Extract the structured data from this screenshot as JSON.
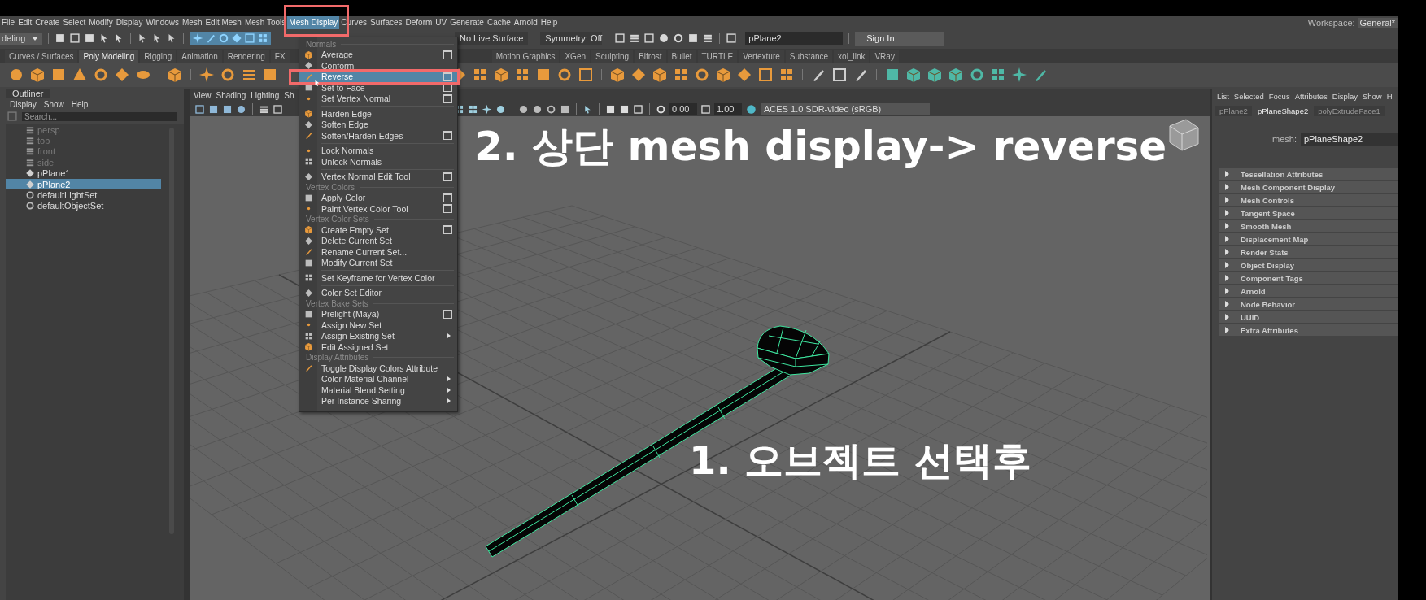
{
  "menu_bar": {
    "items": [
      {
        "label": "File",
        "selected": false
      },
      {
        "label": "Edit",
        "selected": false
      },
      {
        "label": "Create",
        "selected": false
      },
      {
        "label": "Select",
        "selected": false
      },
      {
        "label": "Modify",
        "selected": false
      },
      {
        "label": "Display",
        "selected": false
      },
      {
        "label": "Windows",
        "selected": false
      },
      {
        "label": "Mesh",
        "selected": false
      },
      {
        "label": "Edit Mesh",
        "selected": false
      },
      {
        "label": "Mesh Tools",
        "selected": false
      },
      {
        "label": "Mesh Display",
        "selected": true
      },
      {
        "label": "Curves",
        "selected": false
      },
      {
        "label": "Surfaces",
        "selected": false
      },
      {
        "label": "Deform",
        "selected": false
      },
      {
        "label": "UV",
        "selected": false
      },
      {
        "label": "Generate",
        "selected": false
      },
      {
        "label": "Cache",
        "selected": false
      },
      {
        "label": "Arnold",
        "selected": false
      },
      {
        "label": "Help",
        "selected": false
      }
    ],
    "workspace_label": "Workspace:",
    "workspace_value": "General*"
  },
  "status_line": {
    "menu_set": "deling",
    "live_surface": "No Live Surface",
    "symmetry": "Symmetry: Off",
    "name_field": "pPlane2",
    "sign_in": "Sign In"
  },
  "shelf": {
    "tabs": [
      {
        "label": "Curves / Surfaces",
        "selected": false
      },
      {
        "label": "Poly Modeling",
        "selected": true
      },
      {
        "label": "Rigging",
        "selected": false
      },
      {
        "label": "Animation",
        "selected": false
      },
      {
        "label": "Rendering",
        "selected": false
      },
      {
        "label": "FX",
        "selected": false
      },
      {
        "label": "Motion Graphics",
        "selected": false
      },
      {
        "label": "XGen",
        "selected": false
      },
      {
        "label": "Sculpting",
        "selected": false
      },
      {
        "label": "Bifrost",
        "selected": false
      },
      {
        "label": "Bullet",
        "selected": false
      },
      {
        "label": "TURTLE",
        "selected": false
      },
      {
        "label": "Vertexture",
        "selected": false
      },
      {
        "label": "Substance",
        "selected": false
      },
      {
        "label": "xol_link",
        "selected": false
      },
      {
        "label": "VRay",
        "selected": false
      }
    ]
  },
  "outliner": {
    "title": "Outliner",
    "menu": [
      "Display",
      "Show",
      "Help"
    ],
    "placeholder": "Search...",
    "items": [
      {
        "label": "persp",
        "kind": "camera",
        "dimmed": true,
        "selected": false
      },
      {
        "label": "top",
        "kind": "camera",
        "dimmed": true,
        "selected": false
      },
      {
        "label": "front",
        "kind": "camera",
        "dimmed": true,
        "selected": false
      },
      {
        "label": "side",
        "kind": "camera",
        "dimmed": true,
        "selected": false
      },
      {
        "label": "pPlane1",
        "kind": "mesh",
        "dimmed": false,
        "selected": false
      },
      {
        "label": "pPlane2",
        "kind": "mesh",
        "dimmed": false,
        "selected": true
      },
      {
        "label": "defaultLightSet",
        "kind": "set",
        "dimmed": false,
        "selected": false
      },
      {
        "label": "defaultObjectSet",
        "kind": "set",
        "dimmed": false,
        "selected": false
      }
    ]
  },
  "viewport": {
    "menu": [
      "View",
      "Shading",
      "Lighting",
      "Sh"
    ],
    "exposure": "0.00",
    "gamma": "1.00",
    "color_space": "ACES 1.0 SDR-video (sRGB)"
  },
  "captions": [
    {
      "text": "2. 상단 mesh display-> reverse"
    },
    {
      "text": "1. 오브젝트 선택후"
    }
  ],
  "mesh_display_menu": {
    "items": [
      {
        "kind": "header",
        "label": "Normals"
      },
      {
        "kind": "item",
        "label": "Average",
        "has_icon": true,
        "option_box": true,
        "submenu": false,
        "highlighted": false
      },
      {
        "kind": "item",
        "label": "Conform",
        "has_icon": true,
        "option_box": false,
        "submenu": false,
        "highlighted": false
      },
      {
        "kind": "item",
        "label": "Reverse",
        "has_icon": true,
        "option_box": true,
        "submenu": false,
        "highlighted": true
      },
      {
        "kind": "item",
        "label": "Set to Face",
        "has_icon": true,
        "option_box": true,
        "submenu": false,
        "highlighted": false
      },
      {
        "kind": "item",
        "label": "Set Vertex Normal",
        "has_icon": true,
        "option_box": true,
        "submenu": false,
        "highlighted": false
      },
      {
        "kind": "separator"
      },
      {
        "kind": "item",
        "label": "Harden Edge",
        "has_icon": true,
        "option_box": false,
        "submenu": false,
        "highlighted": false
      },
      {
        "kind": "item",
        "label": "Soften Edge",
        "has_icon": true,
        "option_box": false,
        "submenu": false,
        "highlighted": false
      },
      {
        "kind": "item",
        "label": "Soften/Harden Edges",
        "has_icon": true,
        "option_box": true,
        "submenu": false,
        "highlighted": false
      },
      {
        "kind": "separator"
      },
      {
        "kind": "item",
        "label": "Lock Normals",
        "has_icon": true,
        "option_box": false,
        "submenu": false,
        "highlighted": false
      },
      {
        "kind": "item",
        "label": "Unlock Normals",
        "has_icon": true,
        "option_box": false,
        "submenu": false,
        "highlighted": false
      },
      {
        "kind": "separator"
      },
      {
        "kind": "item",
        "label": "Vertex Normal Edit Tool",
        "has_icon": true,
        "option_box": true,
        "submenu": false,
        "highlighted": false
      },
      {
        "kind": "header",
        "label": "Vertex Colors"
      },
      {
        "kind": "item",
        "label": "Apply Color",
        "has_icon": true,
        "option_box": true,
        "submenu": false,
        "highlighted": false
      },
      {
        "kind": "item",
        "label": "Paint Vertex Color Tool",
        "has_icon": true,
        "option_box": true,
        "submenu": false,
        "highlighted": false
      },
      {
        "kind": "header",
        "label": "Vertex Color Sets"
      },
      {
        "kind": "item",
        "label": "Create Empty Set",
        "has_icon": true,
        "option_box": true,
        "submenu": false,
        "highlighted": false
      },
      {
        "kind": "item",
        "label": "Delete Current Set",
        "has_icon": true,
        "option_box": false,
        "submenu": false,
        "highlighted": false
      },
      {
        "kind": "item",
        "label": "Rename Current Set...",
        "has_icon": true,
        "option_box": false,
        "submenu": false,
        "highlighted": false
      },
      {
        "kind": "item",
        "label": "Modify Current Set",
        "has_icon": true,
        "option_box": false,
        "submenu": false,
        "highlighted": false
      },
      {
        "kind": "separator"
      },
      {
        "kind": "item",
        "label": "Set Keyframe for Vertex Color",
        "has_icon": true,
        "option_box": false,
        "submenu": false,
        "highlighted": false
      },
      {
        "kind": "separator"
      },
      {
        "kind": "item",
        "label": "Color Set Editor",
        "has_icon": true,
        "option_box": false,
        "submenu": false,
        "highlighted": false
      },
      {
        "kind": "header",
        "label": "Vertex Bake Sets"
      },
      {
        "kind": "item",
        "label": "Prelight (Maya)",
        "has_icon": true,
        "option_box": true,
        "submenu": false,
        "highlighted": false
      },
      {
        "kind": "item",
        "label": "Assign New Set",
        "has_icon": true,
        "option_box": false,
        "submenu": false,
        "highlighted": false
      },
      {
        "kind": "item",
        "label": "Assign Existing Set",
        "has_icon": true,
        "option_box": false,
        "submenu": true,
        "highlighted": false
      },
      {
        "kind": "item",
        "label": "Edit Assigned Set",
        "has_icon": true,
        "option_box": false,
        "submenu": false,
        "highlighted": false
      },
      {
        "kind": "header",
        "label": "Display Attributes"
      },
      {
        "kind": "item",
        "label": "Toggle Display Colors Attribute",
        "has_icon": true,
        "option_box": false,
        "submenu": false,
        "highlighted": false
      },
      {
        "kind": "item",
        "label": "Color Material Channel",
        "has_icon": false,
        "option_box": false,
        "submenu": true,
        "highlighted": false
      },
      {
        "kind": "item",
        "label": "Material Blend Setting",
        "has_icon": false,
        "option_box": false,
        "submenu": true,
        "highlighted": false
      },
      {
        "kind": "item",
        "label": "Per Instance Sharing",
        "has_icon": false,
        "option_box": false,
        "submenu": true,
        "highlighted": false
      }
    ]
  },
  "attribute_editor": {
    "menu": [
      "List",
      "Selected",
      "Focus",
      "Attributes",
      "Display",
      "Show",
      "H"
    ],
    "tabs": [
      {
        "label": "pPlane2",
        "selected": false
      },
      {
        "label": "pPlaneShape2",
        "selected": true
      },
      {
        "label": "polyExtrudeFace1",
        "selected": false
      }
    ],
    "node_label": "mesh:",
    "node_value": "pPlaneShape2",
    "sections": [
      {
        "label": "Tessellation Attributes",
        "expanded": false
      },
      {
        "label": "Mesh Component Display",
        "expanded": false
      },
      {
        "label": "Mesh Controls",
        "expanded": false
      },
      {
        "label": "Tangent Space",
        "expanded": false
      },
      {
        "label": "Smooth Mesh",
        "expanded": false
      },
      {
        "label": "Displacement Map",
        "expanded": false
      },
      {
        "label": "Render Stats",
        "expanded": false
      },
      {
        "label": "Object Display",
        "expanded": false
      },
      {
        "label": "Component Tags",
        "expanded": false
      },
      {
        "label": "Arnold",
        "expanded": false
      },
      {
        "label": "Node Behavior",
        "expanded": false
      },
      {
        "label": "UUID",
        "expanded": false
      },
      {
        "label": "Extra Attributes",
        "expanded": false
      }
    ]
  }
}
